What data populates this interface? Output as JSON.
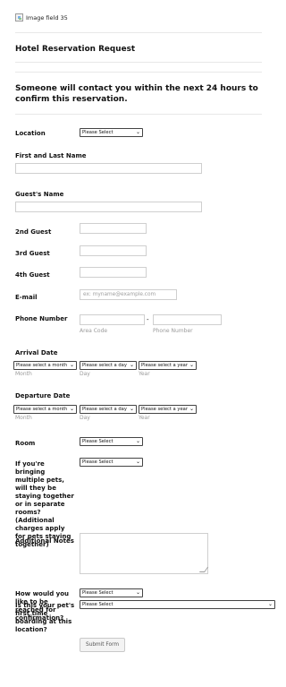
{
  "page": {
    "image_field_alt": "Image field 35",
    "title": "Hotel Reservation Request",
    "confirmation_note": "Someone will contact you within the next 24 hours to confirm this reservation.",
    "fields": {
      "location_label": "Location",
      "first_last_name_label": "First and Last Name",
      "guests_name_label": "Guest's Name",
      "guest2_label": "2nd Guest",
      "guest3_label": "3rd Guest",
      "guest4_label": "4th Guest",
      "email_label": "E-mail",
      "email_placeholder": "ex: myname@example.com",
      "phone_label": "Phone Number",
      "phone_area_code_caption": "Area Code",
      "phone_number_caption": "Phone Number",
      "phone_separator": "-",
      "arrival_date_label": "Arrival Date",
      "departure_date_label": "Departure Date",
      "date_month_option": "Please select a month",
      "date_day_option": "Please select a day",
      "date_year_option": "Please select a year",
      "month_caption": "Month",
      "day_caption": "Day",
      "year_caption": "Year",
      "room_label": "Room",
      "pets_label": "If you're bringing multiple pets, will they be staying together or in separate rooms? (Additional charges apply for pets staying together)",
      "additional_notes_label": "Additional Notes",
      "confirmation_method_label": "How would you like to be reached for confirmation?",
      "first_time_boarding_label": "Is this your pet's first time boarding at this location?",
      "please_select_option": "Please Select"
    },
    "submit_label": "Submit Form",
    "icons": {
      "dropdown": "chevron-down-icon",
      "image": "broken-image-icon",
      "resize": "resize-handle-icon"
    }
  }
}
